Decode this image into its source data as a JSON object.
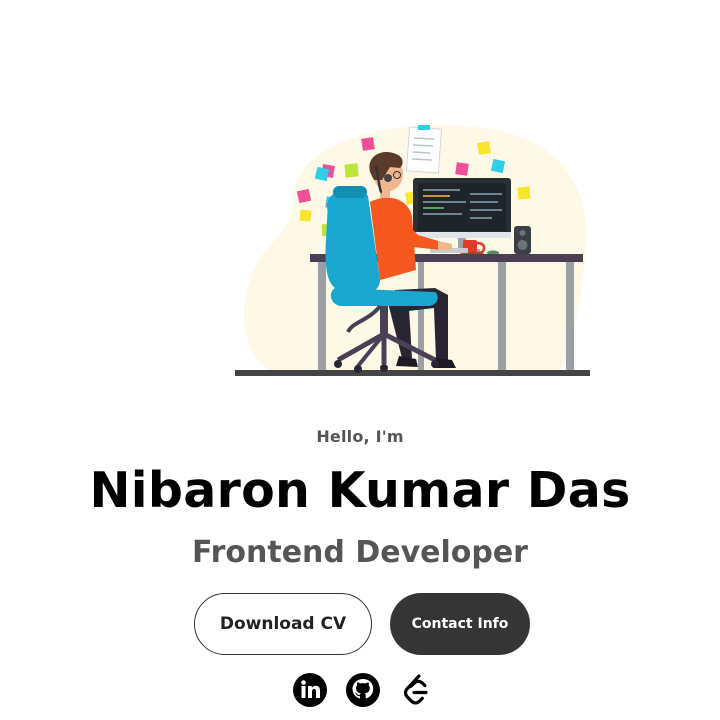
{
  "hero": {
    "greeting": "Hello, I'm",
    "name": "Nibaron Kumar Das",
    "role": "Frontend Developer"
  },
  "actions": {
    "download_label": "Download CV",
    "contact_label": "Contact Info"
  },
  "socials": [
    {
      "icon": "linkedin-icon"
    },
    {
      "icon": "github-icon"
    },
    {
      "icon": "leetcode-icon"
    }
  ],
  "colors": {
    "text_primary": "#000000",
    "text_secondary": "#555555",
    "button_dark": "#353535",
    "blob_background": "#fdf9e6",
    "chair_blue": "#1aa7cf",
    "shirt_orange": "#f5571f"
  }
}
